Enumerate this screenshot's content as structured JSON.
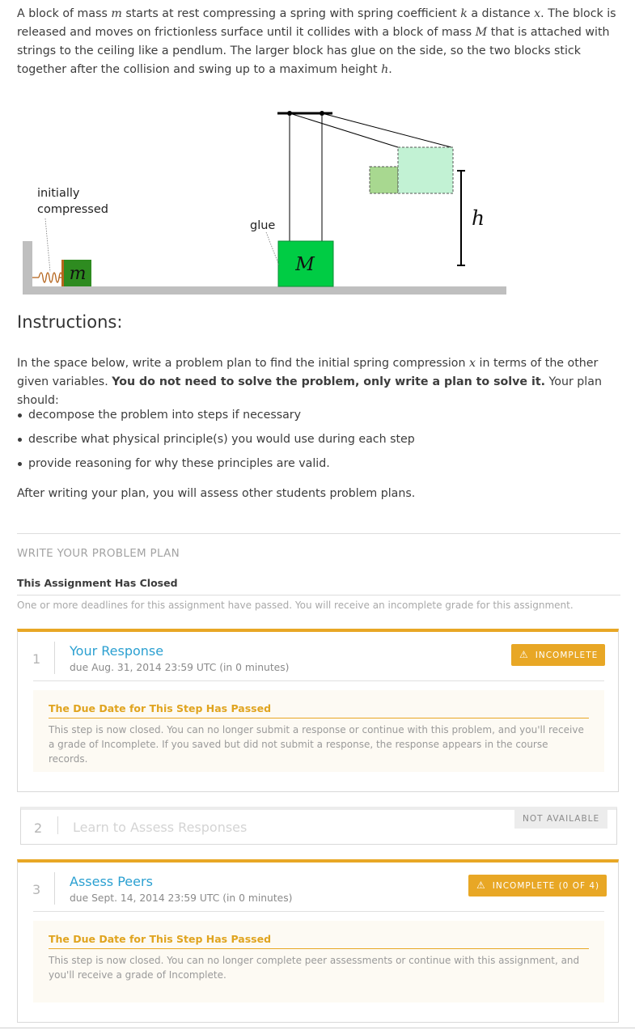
{
  "problem": {
    "p1": "A block of mass ",
    "m": "m",
    "p2": " starts at rest compressing a spring with spring coefficient ",
    "k": "k",
    "p3": " a distance ",
    "x": "x",
    "p4": ". The block is released and moves on frictionless surface until it collides with a block of mass ",
    "M": "M",
    "p5": " that is attached with strings to the ceiling like a pendlum. The larger block has glue on the side, so the two blocks stick together after the collision and swing up to a maximum height ",
    "h": "h",
    "p6": "."
  },
  "diagram": {
    "label_initially": "initially",
    "label_compressed": "compressed",
    "label_glue": "glue",
    "small_block": "m",
    "big_block": "M",
    "height": "h",
    "colors": {
      "small_block": "#2e8b20",
      "big_block": "#00cc44",
      "swing_small": "#a8d890",
      "swing_big": "#c2f2d4",
      "floor": "#bfbfbf",
      "spring": "#b5651d"
    }
  },
  "instructions": {
    "title": "Instructions:",
    "p1": "In the space below, write a problem plan to find the initial spring compression ",
    "x": "x",
    "p2": " in terms of the other given variables. ",
    "bold": "You do not need to solve the problem, only write a plan to solve it.",
    "p3": " Your plan should:",
    "bullets": [
      "decompose the problem into steps if necessary",
      "describe what physical principle(s) you would use during each step",
      "provide reasoning for why these principles are valid."
    ],
    "after": "After writing your plan, you will assess other students problem plans."
  },
  "section": {
    "title": "WRITE YOUR PROBLEM PLAN",
    "closed_title": "This Assignment Has Closed",
    "closed_desc": "One or more deadlines for this assignment have passed. You will receive an incomplete grade for this assignment."
  },
  "steps": [
    {
      "number": "1",
      "title": "Your Response",
      "due": "due Aug. 31, 2014 23:59 UTC (in 0 minutes)",
      "badge": "INCOMPLETE",
      "notice_title": "The Due Date for This Step Has Passed",
      "notice_text": "This step is now closed. You can no longer submit a response or continue with this problem, and you'll receive a grade of Incomplete. If you saved but did not submit a response, the response appears in the course records."
    },
    {
      "number": "2",
      "title": "Learn to Assess Responses",
      "badge": "NOT AVAILABLE"
    },
    {
      "number": "3",
      "title": "Assess Peers",
      "due": "due Sept. 14, 2014 23:59 UTC (in 0 minutes)",
      "badge": "INCOMPLETE (0 OF 4)",
      "notice_title": "The Due Date for This Step Has Passed",
      "notice_text": "This step is now closed. You can no longer complete peer assessments or continue with this assignment, and you'll receive a grade of Incomplete."
    }
  ],
  "icons": {
    "warning": "warning-icon"
  }
}
